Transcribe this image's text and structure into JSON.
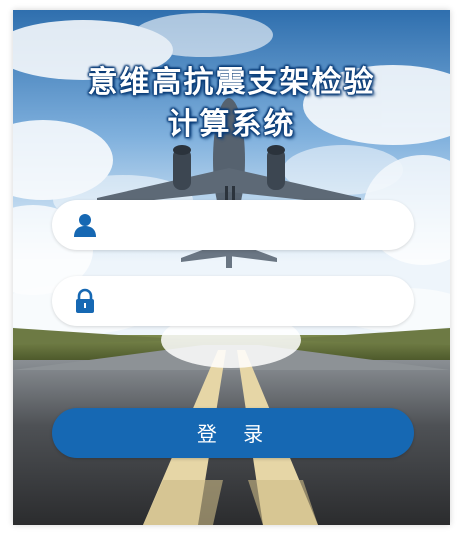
{
  "app": {
    "title_line1": "意维高抗震支架检验",
    "title_line2": "计算系统"
  },
  "form": {
    "username": {
      "value": "",
      "placeholder": "",
      "icon": "user-icon"
    },
    "password": {
      "value": "",
      "placeholder": "",
      "icon": "lock-icon"
    },
    "login_label": "登 录"
  },
  "colors": {
    "accent": "#1668b3",
    "title_stroke": "#0b3d78",
    "field_bg": "#ffffff"
  }
}
